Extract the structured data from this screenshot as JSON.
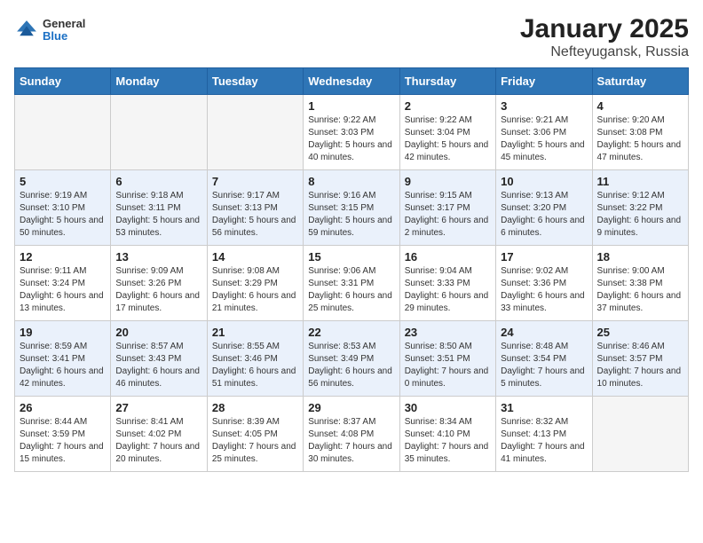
{
  "header": {
    "logo_general": "General",
    "logo_blue": "Blue",
    "title": "January 2025",
    "subtitle": "Nefteyugansk, Russia"
  },
  "weekdays": [
    "Sunday",
    "Monday",
    "Tuesday",
    "Wednesday",
    "Thursday",
    "Friday",
    "Saturday"
  ],
  "weeks": [
    [
      {
        "day": "",
        "info": ""
      },
      {
        "day": "",
        "info": ""
      },
      {
        "day": "",
        "info": ""
      },
      {
        "day": "1",
        "info": "Sunrise: 9:22 AM\nSunset: 3:03 PM\nDaylight: 5 hours and 40 minutes."
      },
      {
        "day": "2",
        "info": "Sunrise: 9:22 AM\nSunset: 3:04 PM\nDaylight: 5 hours and 42 minutes."
      },
      {
        "day": "3",
        "info": "Sunrise: 9:21 AM\nSunset: 3:06 PM\nDaylight: 5 hours and 45 minutes."
      },
      {
        "day": "4",
        "info": "Sunrise: 9:20 AM\nSunset: 3:08 PM\nDaylight: 5 hours and 47 minutes."
      }
    ],
    [
      {
        "day": "5",
        "info": "Sunrise: 9:19 AM\nSunset: 3:10 PM\nDaylight: 5 hours and 50 minutes."
      },
      {
        "day": "6",
        "info": "Sunrise: 9:18 AM\nSunset: 3:11 PM\nDaylight: 5 hours and 53 minutes."
      },
      {
        "day": "7",
        "info": "Sunrise: 9:17 AM\nSunset: 3:13 PM\nDaylight: 5 hours and 56 minutes."
      },
      {
        "day": "8",
        "info": "Sunrise: 9:16 AM\nSunset: 3:15 PM\nDaylight: 5 hours and 59 minutes."
      },
      {
        "day": "9",
        "info": "Sunrise: 9:15 AM\nSunset: 3:17 PM\nDaylight: 6 hours and 2 minutes."
      },
      {
        "day": "10",
        "info": "Sunrise: 9:13 AM\nSunset: 3:20 PM\nDaylight: 6 hours and 6 minutes."
      },
      {
        "day": "11",
        "info": "Sunrise: 9:12 AM\nSunset: 3:22 PM\nDaylight: 6 hours and 9 minutes."
      }
    ],
    [
      {
        "day": "12",
        "info": "Sunrise: 9:11 AM\nSunset: 3:24 PM\nDaylight: 6 hours and 13 minutes."
      },
      {
        "day": "13",
        "info": "Sunrise: 9:09 AM\nSunset: 3:26 PM\nDaylight: 6 hours and 17 minutes."
      },
      {
        "day": "14",
        "info": "Sunrise: 9:08 AM\nSunset: 3:29 PM\nDaylight: 6 hours and 21 minutes."
      },
      {
        "day": "15",
        "info": "Sunrise: 9:06 AM\nSunset: 3:31 PM\nDaylight: 6 hours and 25 minutes."
      },
      {
        "day": "16",
        "info": "Sunrise: 9:04 AM\nSunset: 3:33 PM\nDaylight: 6 hours and 29 minutes."
      },
      {
        "day": "17",
        "info": "Sunrise: 9:02 AM\nSunset: 3:36 PM\nDaylight: 6 hours and 33 minutes."
      },
      {
        "day": "18",
        "info": "Sunrise: 9:00 AM\nSunset: 3:38 PM\nDaylight: 6 hours and 37 minutes."
      }
    ],
    [
      {
        "day": "19",
        "info": "Sunrise: 8:59 AM\nSunset: 3:41 PM\nDaylight: 6 hours and 42 minutes."
      },
      {
        "day": "20",
        "info": "Sunrise: 8:57 AM\nSunset: 3:43 PM\nDaylight: 6 hours and 46 minutes."
      },
      {
        "day": "21",
        "info": "Sunrise: 8:55 AM\nSunset: 3:46 PM\nDaylight: 6 hours and 51 minutes."
      },
      {
        "day": "22",
        "info": "Sunrise: 8:53 AM\nSunset: 3:49 PM\nDaylight: 6 hours and 56 minutes."
      },
      {
        "day": "23",
        "info": "Sunrise: 8:50 AM\nSunset: 3:51 PM\nDaylight: 7 hours and 0 minutes."
      },
      {
        "day": "24",
        "info": "Sunrise: 8:48 AM\nSunset: 3:54 PM\nDaylight: 7 hours and 5 minutes."
      },
      {
        "day": "25",
        "info": "Sunrise: 8:46 AM\nSunset: 3:57 PM\nDaylight: 7 hours and 10 minutes."
      }
    ],
    [
      {
        "day": "26",
        "info": "Sunrise: 8:44 AM\nSunset: 3:59 PM\nDaylight: 7 hours and 15 minutes."
      },
      {
        "day": "27",
        "info": "Sunrise: 8:41 AM\nSunset: 4:02 PM\nDaylight: 7 hours and 20 minutes."
      },
      {
        "day": "28",
        "info": "Sunrise: 8:39 AM\nSunset: 4:05 PM\nDaylight: 7 hours and 25 minutes."
      },
      {
        "day": "29",
        "info": "Sunrise: 8:37 AM\nSunset: 4:08 PM\nDaylight: 7 hours and 30 minutes."
      },
      {
        "day": "30",
        "info": "Sunrise: 8:34 AM\nSunset: 4:10 PM\nDaylight: 7 hours and 35 minutes."
      },
      {
        "day": "31",
        "info": "Sunrise: 8:32 AM\nSunset: 4:13 PM\nDaylight: 7 hours and 41 minutes."
      },
      {
        "day": "",
        "info": ""
      }
    ]
  ]
}
